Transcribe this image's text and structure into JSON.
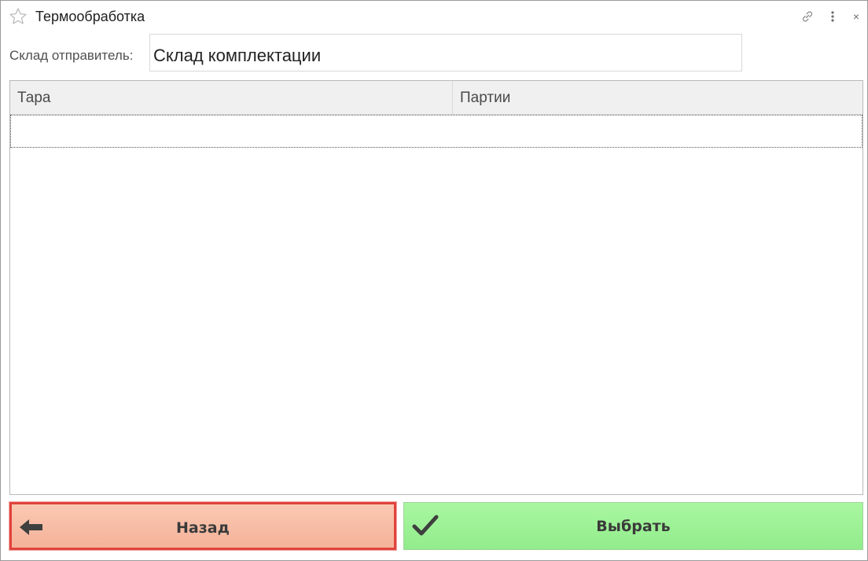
{
  "window": {
    "title": "Термообработка",
    "icons": {
      "favorite": "star-icon",
      "link": "link-icon",
      "more": "more-icon",
      "close": "close-icon"
    },
    "close_glyph": "×"
  },
  "form": {
    "sender_label": "Склад отправитель:",
    "sender_value": "Склад комплектации"
  },
  "table": {
    "columns": [
      "Тара",
      "Партии"
    ],
    "rows": []
  },
  "buttons": {
    "back": {
      "label": "Назад",
      "icon": "arrow-left-icon",
      "color": "#f7bda5",
      "border": "#e0433d"
    },
    "select": {
      "label": "Выбрать",
      "icon": "check-icon",
      "color": "#9ff197"
    }
  }
}
